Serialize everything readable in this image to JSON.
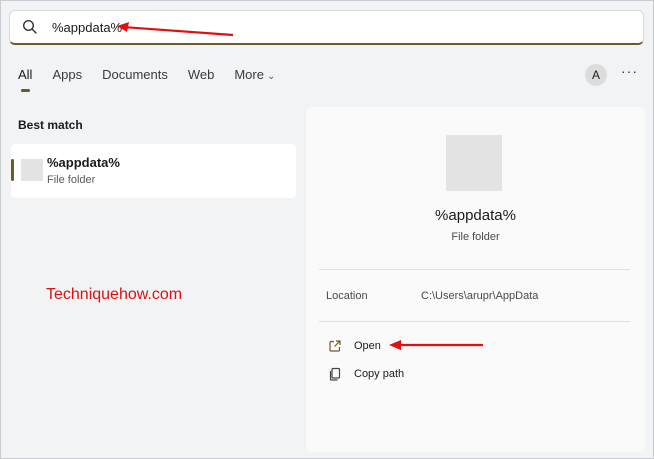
{
  "search": {
    "value": "%appdata%"
  },
  "tabs": [
    {
      "label": "All"
    },
    {
      "label": "Apps"
    },
    {
      "label": "Documents"
    },
    {
      "label": "Web"
    },
    {
      "label": "More"
    }
  ],
  "header": {
    "avatar_letter": "A",
    "more_menu": "···"
  },
  "best_match": {
    "heading": "Best match",
    "item": {
      "name": "%appdata%",
      "type": "File folder"
    }
  },
  "watermark": "Techniquehow.com",
  "detail": {
    "title": "%appdata%",
    "subtitle": "File folder",
    "location_label": "Location",
    "location_value": "C:\\Users\\arupr\\AppData",
    "actions": [
      {
        "label": "Open",
        "icon": "open-external-icon"
      },
      {
        "label": "Copy path",
        "icon": "copy-icon"
      }
    ]
  },
  "colors": {
    "accent": "#6b5a2e",
    "annotation": "#e01010"
  }
}
